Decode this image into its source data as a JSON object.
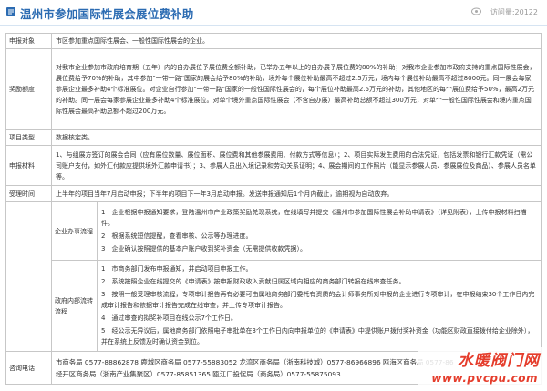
{
  "header": {
    "title": "温州市参加国际性展会展位费补助",
    "views": "访问量:20122"
  },
  "rows": {
    "target": {
      "label": "申报对象",
      "text": "市区参加重点国际性展会、一般性国际性展会的企业。"
    },
    "award": {
      "label": "奖励额度",
      "text": "对我市企业参加市政府培育期（五年）内的自办展位予展位费全额补助，已举办五年以上的自办展予展位费的80%的补助；对我市企业参加市政府支持的重点国际性展会，展位费给予70%的补助，其中参加\"一带一路\"国家的展会给予80%的补助，境外每个展位补助最高不超过2.5万元，境内每个展位补助最高不超过8000元。同一展会每家参展企业最多补助4个标准展位。对企业自行参加\"一带一路\"国家的一般性国际性展会的，每个展位补助最高2.5万元的补助，其他地区的每个展位费给予50%，最高2万元的补助。同一展会每家参展企业最多补助4个标准展位。对单个境外重点国际性展会（不含自办展）最高补助总额不超过300万元，对单个一般性国际性展会和境内重点国际性展会最高补助总额不超过200万元。"
    },
    "type": {
      "label": "项目类型",
      "text": "数据核定类。"
    },
    "materials": {
      "label": "申报材料",
      "text": "1、与组展方签订的展会合同（应有展位数量、展位面积、展位费和其他参展费用、付款方式等信息）；2、项目实际发生费用的合法凭证，包括发票和银行汇款凭证（需公司账户支付，如外汇付款应提供境外汇款申请书）；3、参展人员出入境记录和劳动关系证明；4、展会期间的工作照片（能显示参展人员、参展展位及商品）、参展人员名单等。"
    },
    "time": {
      "label": "受理时间",
      "text": "上半年的项目当年7月启动申报；下半年的项目下一年3月启动申报。发送申报通知后1个月内截止，逾期视为自动放弃。"
    },
    "process": {
      "label": "企业办事流程",
      "steps": [
        "1　企业根据申报通知要求，登陆温州市产业政策奖励兑现系统，在线填写并提交《温州市参加国际性展会补助申请表》（详见附表），上传申报材料扫描件。",
        "2　根据系统短信提醒，查看审核、公示等办理进度。",
        "3　企业确认按照提供的基本户账户收到奖补资金（无需提供收款凭据）。"
      ]
    },
    "gov": {
      "label": "政府内部流转流程",
      "steps": [
        "1　市商务部门发布申报通知，并启动项目申报工作。",
        "2　系统按照企业在线提交的《申请表》按申报财政收入贡献归属区域向相应的商务部门转报在线审查任务。",
        "3　按照一般受理审核流程，专项审计报告再有必要可由属地商务部门委托有资质的会计师事务所对申报的企业进行专项审计，在申报结束30个工作日内完成审计报告和依据审计报告完成在线审查，并上传专项审计报告。",
        "4　通过审查的拟奖补项目在线公示7个工作日。",
        "5　经公示无异议后，属地商务部门依照电子审批单在3个工作日内向申报单位的《申请表》中提供账户拨付奖补资金（功能区财政直接拨付给企业除外），并在系统上反馈及时确认资金到位。"
      ]
    },
    "contact": {
      "label": "咨询电话",
      "lines": [
        "市商务局 0577-88862878  鹿城区商务局 0577-55883052  龙湾区商务局（浙南科技城）0577-86966896  瓯海区商务局 0577-86",
        "经开区商务局（浙南产业集聚区）0577-85851365  瓯江口投促局（商务局）0577-55875093"
      ]
    }
  },
  "watermark": {
    "top": "水暖阀门网",
    "bottom": "www.pvcpu.com"
  },
  "colors": {
    "title": "#2b6bb2",
    "border": "#c7c7c7",
    "watermark": "#e53d2c"
  }
}
